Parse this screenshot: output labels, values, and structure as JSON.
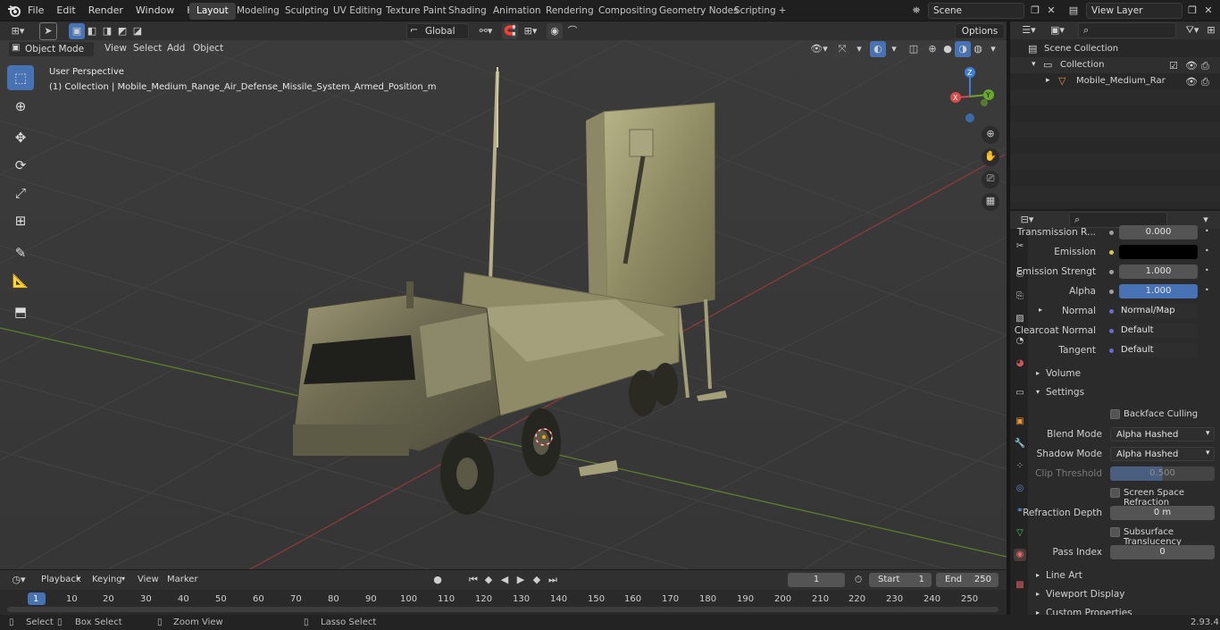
{
  "topbar": {
    "menus": [
      "File",
      "Edit",
      "Render",
      "Window",
      "Help"
    ],
    "workspaces": [
      "Layout",
      "Modeling",
      "Sculpting",
      "UV Editing",
      "Texture Paint",
      "Shading",
      "Animation",
      "Rendering",
      "Compositing",
      "Geometry Nodes",
      "Scripting"
    ],
    "active_workspace": "Layout",
    "add_tab": "+",
    "scene": "Scene",
    "view_layer": "View Layer"
  },
  "viewport_header": {
    "mode": "Object Mode",
    "menus": [
      "View",
      "Select",
      "Add",
      "Object"
    ],
    "orientation": "Global",
    "options": "Options"
  },
  "viewport": {
    "perspective": "User Perspective",
    "object_info": "(1) Collection | Mobile_Medium_Range_Air_Defense_Missile_System_Armed_Position_m",
    "gizmo": {
      "x": "X",
      "y": "Y",
      "z": "Z"
    }
  },
  "outliner": {
    "scene_collection": "Scene Collection",
    "collection": "Collection",
    "object": "Mobile_Medium_Range_A"
  },
  "properties": {
    "rows": [
      {
        "label": "Transmission R...",
        "value": "0.000"
      },
      {
        "label": "Emission",
        "value": ""
      },
      {
        "label": "Emission Strengt",
        "value": "1.000"
      },
      {
        "label": "Alpha",
        "value": "1.000"
      },
      {
        "label": "Normal",
        "value": "Normal/Map"
      },
      {
        "label": "Clearcoat Normal",
        "value": "Default"
      },
      {
        "label": "Tangent",
        "value": "Default"
      }
    ],
    "volume": "Volume",
    "settings": "Settings",
    "backface_culling": "Backface Culling",
    "blend_mode_label": "Blend Mode",
    "blend_mode": "Alpha Hashed",
    "shadow_mode_label": "Shadow Mode",
    "shadow_mode": "Alpha Hashed",
    "clip_threshold_label": "Clip Threshold",
    "clip_threshold": "0.500",
    "screen_space_refraction": "Screen Space Refraction",
    "refraction_depth_label": "Refraction Depth",
    "refraction_depth": "0 m",
    "subsurface_translucency": "Subsurface Translucency",
    "pass_index_label": "Pass Index",
    "pass_index": "0",
    "line_art": "Line Art",
    "viewport_display": "Viewport Display",
    "custom_properties": "Custom Properties"
  },
  "timeline": {
    "menus": [
      "Playback",
      "Keying",
      "View",
      "Marker"
    ],
    "current_frame": "1",
    "start_label": "Start",
    "start": "1",
    "end_label": "End",
    "end": "250",
    "ticks": [
      "1",
      "10",
      "20",
      "30",
      "40",
      "50",
      "60",
      "70",
      "80",
      "90",
      "100",
      "110",
      "120",
      "130",
      "140",
      "150",
      "160",
      "170",
      "180",
      "190",
      "200",
      "210",
      "220",
      "230",
      "240",
      "250"
    ]
  },
  "statusbar": {
    "select": "Select",
    "box_select": "Box Select",
    "zoom_view": "Zoom View",
    "lasso_select": "Lasso Select",
    "version": "2.93.4"
  },
  "colors": {
    "accent": "#4772b3",
    "grid_x": "#8a3a3a",
    "grid_y": "#5d7d2b",
    "camo": "#a9a57a"
  }
}
